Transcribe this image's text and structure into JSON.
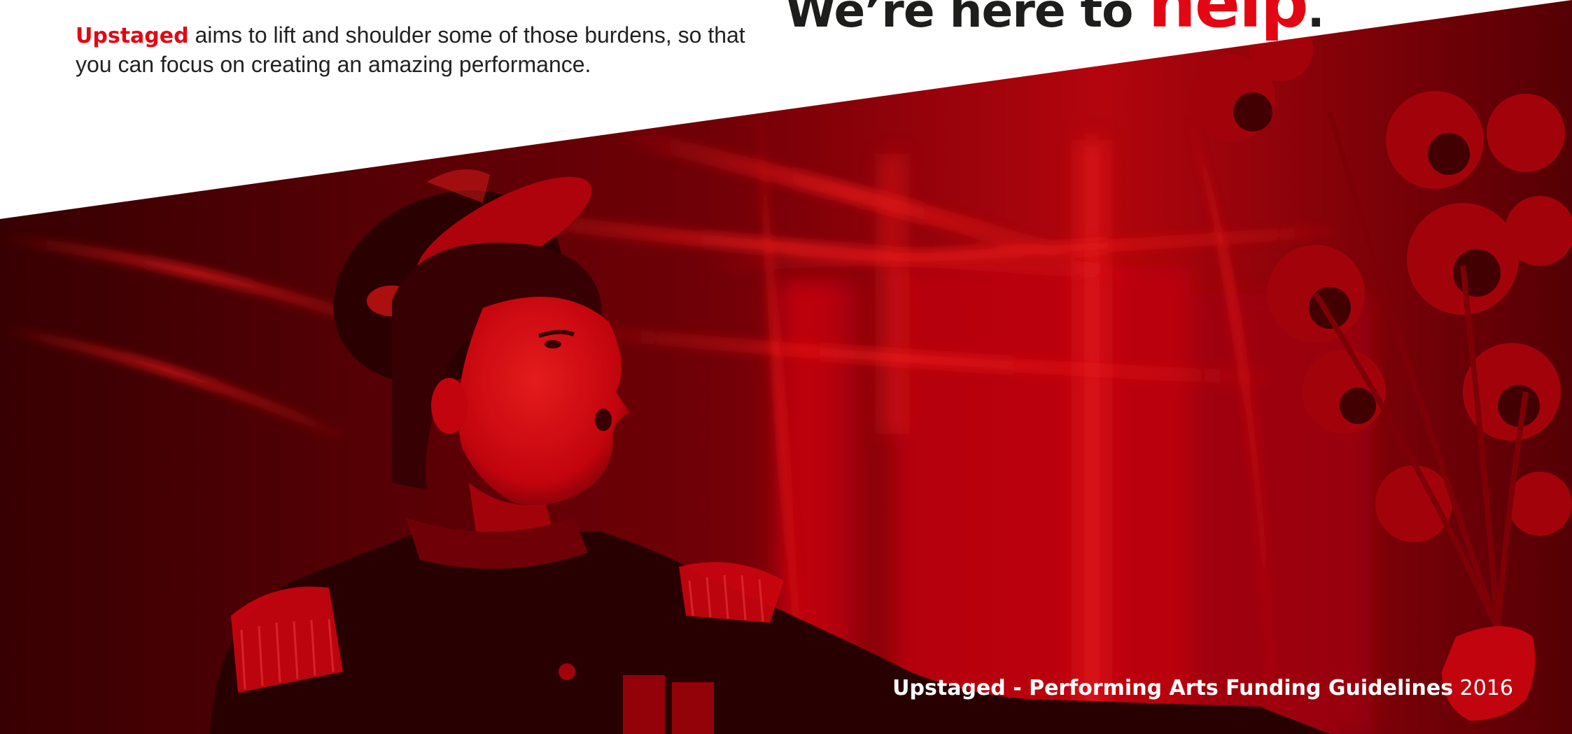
{
  "intro": {
    "brand": "Upstaged",
    "text": " aims to lift and shoulder some of those burdens, so that you can focus on creating an amazing performance."
  },
  "headline": {
    "prefix": "We’re here to ",
    "accent": "help",
    "suffix": "."
  },
  "footer": {
    "title": "Upstaged - Performing Arts Funding Guidelines",
    "year": " 2016"
  },
  "colors": {
    "brand_red": "#e30613",
    "dark_text": "#1d1d1b",
    "photo_dark": "#2a0002"
  }
}
